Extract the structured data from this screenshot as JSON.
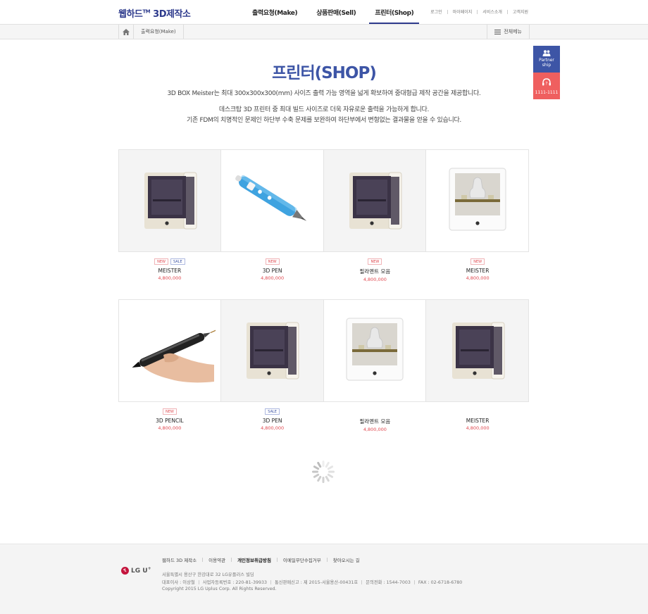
{
  "header": {
    "logo": "웹하드",
    "logo_tm": "TM",
    "logo_sub": "3D제작소",
    "nav": [
      "출력요청(Make)",
      "상품판매(Sell)",
      "프린터(Shop)"
    ],
    "util": [
      "로그인",
      "마이페이지",
      "서비스소개",
      "고객지원"
    ]
  },
  "location": {
    "crumb": "출력요청(Make)",
    "all_menu": "전체메뉴"
  },
  "quick": {
    "partner_line1": "Partner",
    "partner_line2": "ship",
    "phone": "1111-1111"
  },
  "intro": {
    "title": "프린터(SHOP)",
    "line1": "3D BOX Meister는 최대 300x300x300(mm) 사이즈 출력 가능 영역을 넓게 확보하여 중대형급 제작 공간을 제공합니다.",
    "line2": "데스크탑 3D 프린터 중 최대 빌드 사이즈로 더욱 자유로운 출력을 가능하게 합니다.",
    "line3": "기존 FDM의 치명적인 문제인 하단부 수축 문제를 보완하여 하단부에서 변형없는 결과물을 얻을 수 있습니다."
  },
  "badge_labels": {
    "new": "NEW",
    "sale": "SALE"
  },
  "products": [
    [
      {
        "name": "MEISTER",
        "price": "4,800,000",
        "new": "NEW",
        "sale": "SALE",
        "image": "meister-printer-icon"
      },
      {
        "name": "3D PEN",
        "price": "4,800,000",
        "new": "NEW",
        "sale": "",
        "image": "3d-pen-icon"
      },
      {
        "name": "필라멘트 모음",
        "price": "4,800,000",
        "new": "NEW",
        "sale": "",
        "image": "meister-printer-icon"
      },
      {
        "name": "MEISTER",
        "price": "4,800,000",
        "new": "NEW",
        "sale": "",
        "image": "open-printer-icon"
      }
    ],
    [
      {
        "name": "3D PENCIL",
        "price": "4,800,000",
        "new": "NEW",
        "sale": "",
        "image": "3d-pencil-in-hand-icon"
      },
      {
        "name": "3D PEN",
        "price": "4,800,000",
        "new": "",
        "sale": "SALE",
        "image": "meister-printer-icon"
      },
      {
        "name": "필라멘트 모음",
        "price": "4,800,000",
        "new": "",
        "sale": "",
        "image": "open-printer-icon"
      },
      {
        "name": "MEISTER",
        "price": "4,800,000",
        "new": "",
        "sale": "",
        "image": "meister-printer-icon"
      }
    ]
  ],
  "footer": {
    "links": [
      "웹하드 3D 제작소",
      "이용약관",
      "개인정보취급방침",
      "이메일무단수집거부",
      "찾아오시는 길"
    ],
    "brand": "LG U",
    "brand_plus": "+",
    "address": "서울특별시 용산구 한강대로 32 LG유플러스 빌딩",
    "ceo": "대표이사 : 이상철",
    "biz_no": "사업자등록번호 : 220-81-39933",
    "mail_order": "통신판매신고 : 제 2015-서울용산-00431호",
    "tel": "문의전화 : 1544-7003",
    "fax": "FAX : 02-6718-6780",
    "copyright": "Copyright 2015 LG Uplus Corp. All Rights Reserved."
  },
  "colors": {
    "brand": "#3d55a6",
    "accent_red": "#ef5f5f",
    "price": "#e0484f"
  }
}
